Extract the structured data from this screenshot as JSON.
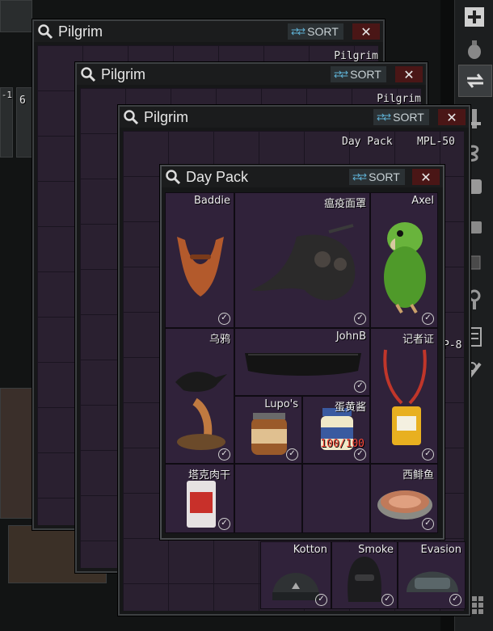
{
  "window_title_1": "Pilgrim",
  "window_title_2": "Pilgrim",
  "window_title_3": "Pilgrim",
  "window_title_4": "Day Pack",
  "sort_label": "SORT",
  "close_glyph": "✕",
  "back_labels": {
    "w1_top": "Pilgrim",
    "w2_top": "Pilgrim",
    "w3_daypack": "Day Pack",
    "w3_mpl": "MPL-50",
    "w3_side": "P-8",
    "left_tab": "-1",
    "left_tab2": "6"
  },
  "daypack_items": [
    {
      "name": "Baddie",
      "icon": "beard-mask"
    },
    {
      "name": "瘟疫面罩",
      "icon": "plague-doctor-mask"
    },
    {
      "name": "Axel",
      "icon": "green-parrot"
    },
    {
      "name": "乌鸦",
      "icon": "crow-figurine"
    },
    {
      "name": "JohnB",
      "icon": "black-band"
    },
    {
      "name": "记者证",
      "icon": "press-pass"
    },
    {
      "name": "Lupo's",
      "icon": "canned-jar"
    },
    {
      "name": "蛋黄酱",
      "icon": "mayo-jar",
      "count": "100/100"
    },
    {
      "name": "塔克肉干",
      "icon": "jerky-pack"
    },
    {
      "name": "西鲱鱼",
      "icon": "fish-tin"
    }
  ],
  "pilgrim_bottom_items": [
    {
      "name": "Kotton",
      "icon": "beanie"
    },
    {
      "name": "Smoke",
      "icon": "balaclava"
    },
    {
      "name": "Evasion",
      "icon": "helmet"
    }
  ],
  "sidebar_icons": [
    "plus-icon",
    "grenade-icon",
    "swap-icon",
    "tool-icon",
    "knot-icon",
    "armor-icon",
    "pouch-icon",
    "key-icon",
    "tag-icon",
    "document-icon",
    "medkit-icon",
    "grid-icon"
  ],
  "colors": {
    "grid": "#30223a",
    "sort_icon": "#5fb2d6",
    "close_bg": "#4a1616",
    "count_red": "#ff4a3a"
  }
}
